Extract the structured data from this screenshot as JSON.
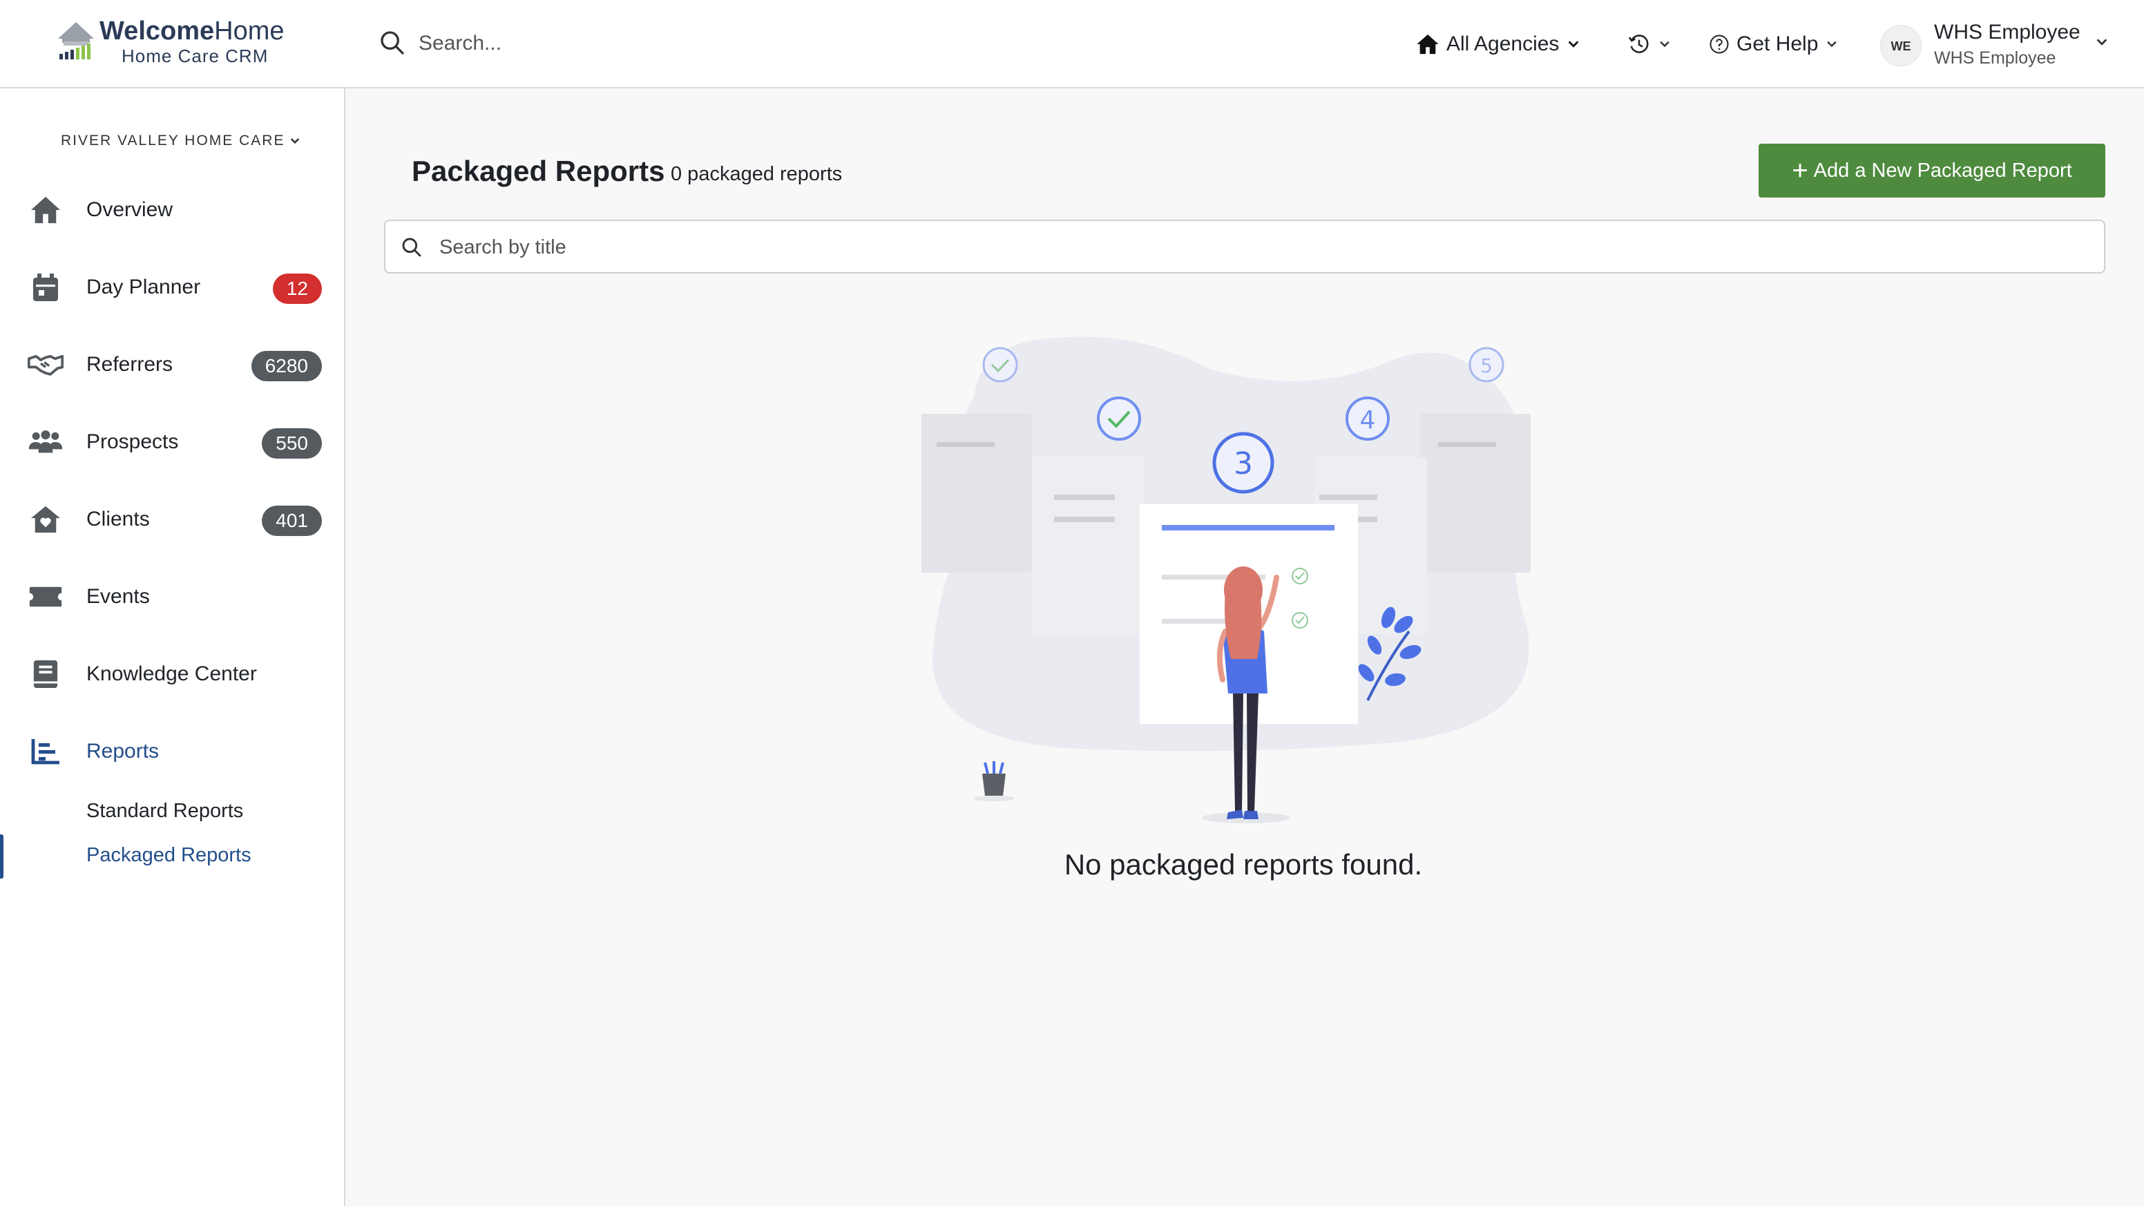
{
  "brand": {
    "name_bold": "Welcome",
    "name_light": "Home",
    "subtitle": "Home Care CRM",
    "accent": "#2b3b57",
    "bars_color": "#8bc34a"
  },
  "topbar": {
    "search_placeholder": "Search...",
    "agencies_label": "All Agencies",
    "help_label": "Get Help",
    "user": {
      "initials": "WE",
      "name": "WHS Employee",
      "role": "WHS Employee"
    }
  },
  "sidebar": {
    "organization": "RIVER VALLEY HOME CARE",
    "items": [
      {
        "label": "Overview",
        "icon": "home-icon"
      },
      {
        "label": "Day Planner",
        "icon": "calendar-icon",
        "badge": "12"
      },
      {
        "label": "Referrers",
        "icon": "handshake-icon",
        "badge": "6280"
      },
      {
        "label": "Prospects",
        "icon": "people-icon",
        "badge": "550"
      },
      {
        "label": "Clients",
        "icon": "house-heart-icon",
        "badge": "401"
      },
      {
        "label": "Events",
        "icon": "ticket-icon"
      },
      {
        "label": "Knowledge Center",
        "icon": "book-icon"
      },
      {
        "label": "Reports",
        "icon": "bar-chart-icon",
        "active": true
      }
    ],
    "report_subitems": [
      {
        "label": "Standard Reports"
      },
      {
        "label": "Packaged Reports",
        "active": true
      }
    ]
  },
  "main": {
    "title": "Packaged Reports",
    "count_text": "0 packaged reports",
    "add_button_label": "Add a New Packaged Report",
    "title_search_placeholder": "Search by title",
    "empty_message": "No packaged reports found.",
    "illustration_step_numbers": [
      "3",
      "4",
      "5"
    ]
  },
  "colors": {
    "primary_button": "#4e8b3f",
    "active_nav": "#234e8c",
    "badge_gray": "#555a5f",
    "badge_red": "#d32f2f",
    "illustration_blue": "#5b7ee6"
  }
}
